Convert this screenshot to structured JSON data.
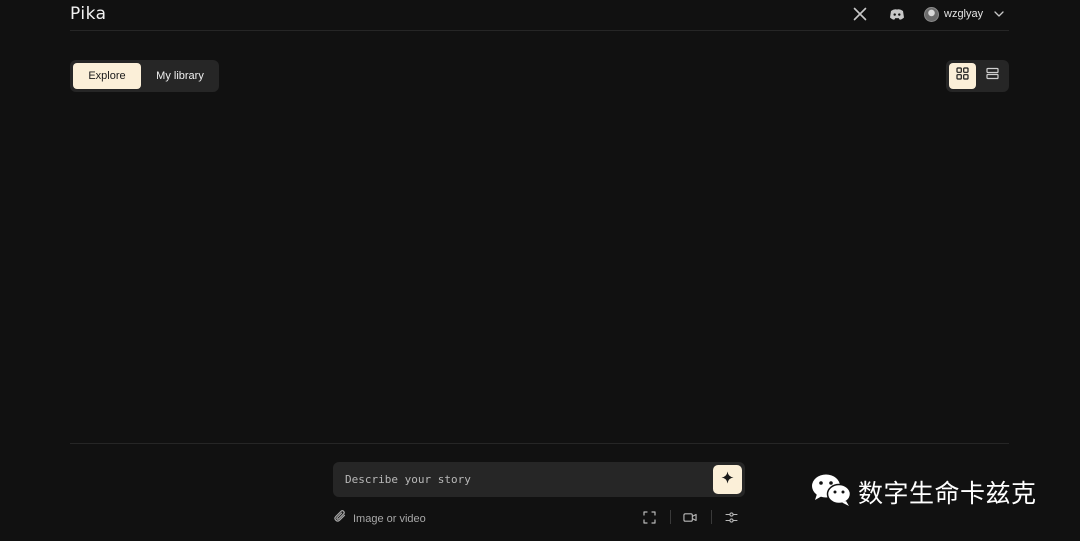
{
  "header": {
    "logo": "Pika",
    "username": "wzglyay"
  },
  "tabs": {
    "explore": "Explore",
    "library": "My library"
  },
  "prompt": {
    "placeholder": "Describe your story"
  },
  "tools": {
    "attach_label": "Image or video"
  },
  "watermark": {
    "text": "数字生命卡兹克"
  },
  "colors": {
    "background": "#111111",
    "surface": "#262626",
    "accent": "#fbefd8"
  }
}
